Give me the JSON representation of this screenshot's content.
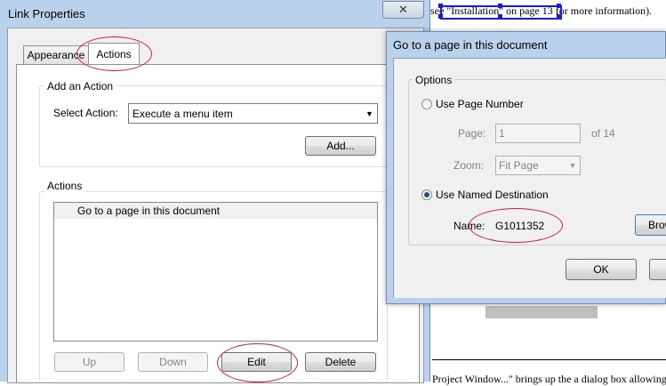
{
  "document": {
    "text_top": "see \"Installation\" on page 13 for more information).",
    "text_bottom": "Project Window...\" brings up the a dialog box allowing you to"
  },
  "link_properties": {
    "title": "Link Properties",
    "close_glyph": "✕",
    "tabs": [
      {
        "label": "Appearance",
        "active": false
      },
      {
        "label": "Actions",
        "active": true
      }
    ],
    "add_action": {
      "group_label": "Add an Action",
      "select_label": "Select Action:",
      "select_value": "Execute a menu item",
      "add_button": "Add..."
    },
    "actions": {
      "group_label": "Actions",
      "items": [
        "Go to a page in this document"
      ]
    },
    "buttons": {
      "up": "Up",
      "down": "Down",
      "edit": "Edit",
      "delete": "Delete"
    }
  },
  "goto_dialog": {
    "title": "Go to a page in this document",
    "options_label": "Options",
    "use_page_number": "Use Page Number",
    "page_label": "Page:",
    "page_value": "1",
    "page_of": "of 14",
    "zoom_label": "Zoom:",
    "zoom_value": "Fit Page",
    "use_named_destination": "Use Named Destination",
    "name_label": "Name:",
    "name_value": "G1011352",
    "browse_button": "Browse...",
    "ok_button": "OK",
    "selected_option": "named_destination"
  },
  "colors": {
    "highlight_ellipse": "#d01f2e",
    "selection": "#1a1adb",
    "window_frame": "#b9d1ea"
  }
}
